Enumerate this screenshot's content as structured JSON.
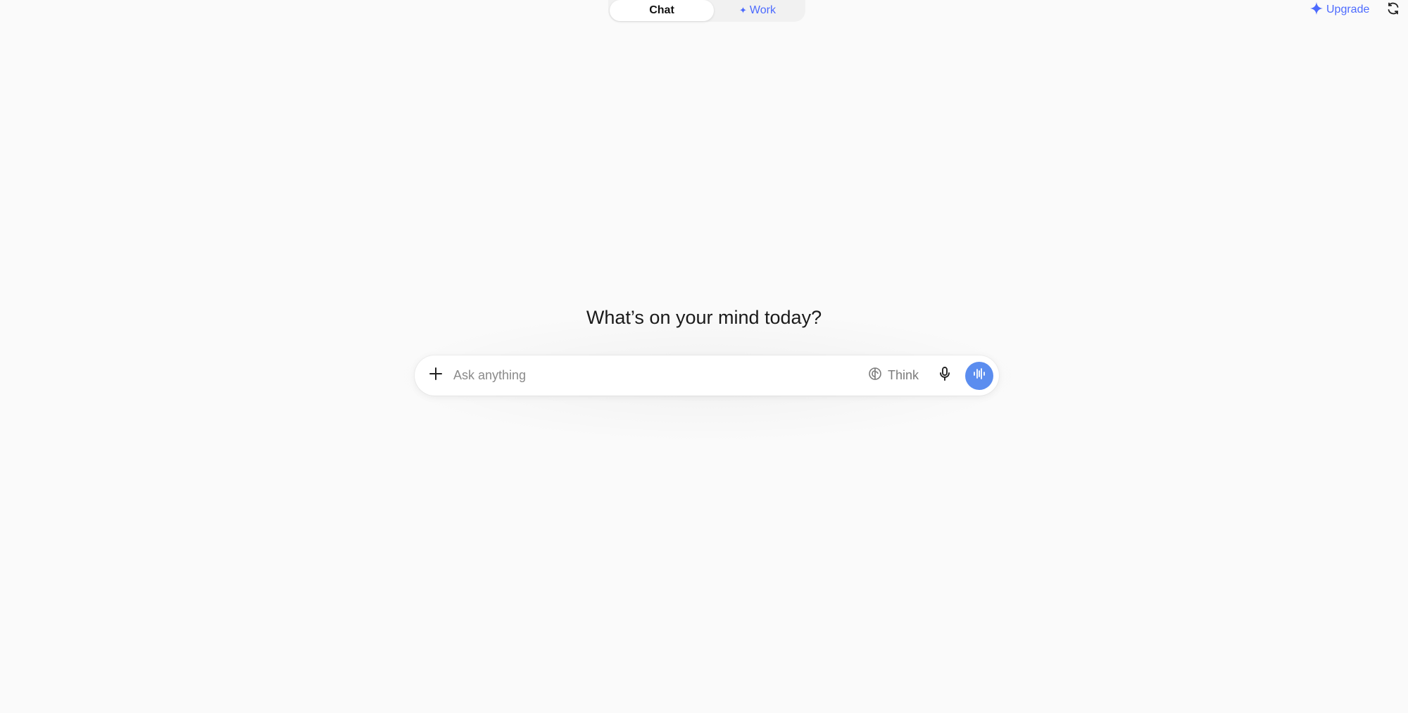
{
  "modes": {
    "chat_label": "Chat",
    "work_label": "Work",
    "work_icon": "sparkle-icon"
  },
  "header": {
    "upgrade_label": "Upgrade",
    "upgrade_icon": "sparkle-icon",
    "refresh_icon": "refresh-icon"
  },
  "main": {
    "headline": "What’s on your mind today?"
  },
  "composer": {
    "placeholder": "Ask anything",
    "value": "",
    "think_label": "Think",
    "attach_icon": "plus-icon",
    "think_icon": "brain-icon",
    "mic_icon": "microphone-icon",
    "voice_icon": "voice-wave-icon"
  },
  "colors": {
    "accent": "#4d6bfe",
    "voice_button": "#5b8def",
    "background": "#fafafa"
  }
}
